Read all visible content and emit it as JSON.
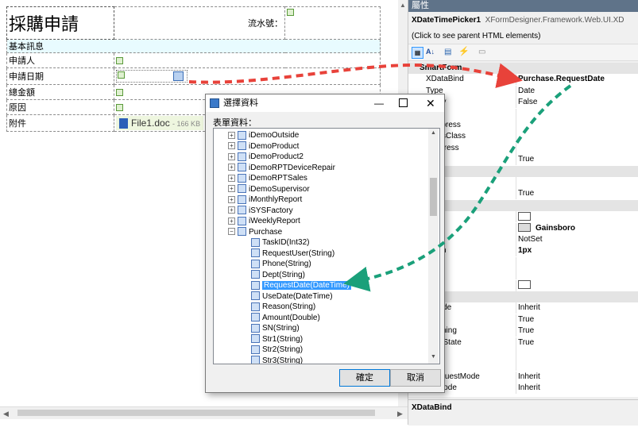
{
  "form": {
    "title": "採購申請",
    "serial_label": "流水號：",
    "section": "基本訊息",
    "rows": [
      {
        "label": "申請人"
      },
      {
        "label": "申請日期"
      },
      {
        "label": "總金額"
      },
      {
        "label": "原因"
      },
      {
        "label": "附件"
      }
    ],
    "attachment": "File1.doc",
    "attachment_size": "- 166 KB"
  },
  "properties": {
    "panel_title": "屬性",
    "component": "XDateTimePicker1",
    "component_type": "XFormDesigner.Framework.Web.UI.XD",
    "parent_link": "(Click to see parent HTML elements)",
    "rows": [
      {
        "kind": "cat",
        "name": "SmartForm",
        "value": ""
      },
      {
        "kind": "prop",
        "name": "XDataBind",
        "value": "Purchase.RequestDate",
        "bold": true
      },
      {
        "kind": "prop",
        "name": "Type",
        "value": "Date"
      },
      {
        "kind": "prop",
        "name": "yOnly",
        "value": "False"
      },
      {
        "kind": "prop",
        "name": "s",
        "value": ""
      },
      {
        "kind": "prop",
        "name": "leExpress",
        "value": ""
      },
      {
        "kind": "prop",
        "name": "leCssClass",
        "value": ""
      },
      {
        "kind": "prop",
        "name": "eExpress",
        "value": ""
      },
      {
        "kind": "prop",
        "name": "t",
        "value": "True"
      },
      {
        "kind": "cat",
        "name": "Mobile",
        "value": ""
      },
      {
        "kind": "prop",
        "name": "ame",
        "value": ""
      },
      {
        "kind": "prop",
        "name": "y",
        "value": "True"
      },
      {
        "kind": "cat",
        "name": "",
        "value": ""
      },
      {
        "kind": "prop",
        "name": "lor",
        "value": "",
        "swatch": "#ffffff"
      },
      {
        "kind": "prop",
        "name": "Color",
        "value": "Gainsboro",
        "swatch": "#dcdcdc",
        "bold": true
      },
      {
        "kind": "prop",
        "name": "Style",
        "value": "NotSet"
      },
      {
        "kind": "prop",
        "name": "Width",
        "value": "1px",
        "bold": true
      },
      {
        "kind": "prop",
        "name": "s",
        "value": ""
      },
      {
        "kind": "prop",
        "name": "",
        "value": ""
      },
      {
        "kind": "prop",
        "name": "olor",
        "value": "",
        "swatch": "#ffffff"
      },
      {
        "kind": "cat",
        "name": "",
        "value": ""
      },
      {
        "kind": "prop",
        "name": "DMode",
        "value": "Inherit"
      },
      {
        "kind": "prop",
        "name": "d",
        "value": "True"
      },
      {
        "kind": "prop",
        "name": "Theming",
        "value": "True"
      },
      {
        "kind": "prop",
        "name": "ViewState",
        "value": "True"
      },
      {
        "kind": "prop",
        "name": "",
        "value": ""
      },
      {
        "kind": "prop",
        "name": "o",
        "value": ""
      },
      {
        "kind": "prop",
        "name": "eRequestMode",
        "value": "Inherit"
      },
      {
        "kind": "prop",
        "name": "ateMode",
        "value": "Inherit"
      }
    ],
    "description_title": "XDataBind"
  },
  "dialog": {
    "title": "選擇資料",
    "label": "表單資料：",
    "tree": [
      {
        "text": "iDemoOutside",
        "level": 0,
        "exp": "+"
      },
      {
        "text": "iDemoProduct",
        "level": 0,
        "exp": "+"
      },
      {
        "text": "iDemoProduct2",
        "level": 0,
        "exp": "+"
      },
      {
        "text": "iDemoRPTDeviceRepair",
        "level": 0,
        "exp": "+"
      },
      {
        "text": "iDemoRPTSales",
        "level": 0,
        "exp": "+"
      },
      {
        "text": "iDemoSupervisor",
        "level": 0,
        "exp": "+"
      },
      {
        "text": "iMonthlyReport",
        "level": 0,
        "exp": "+"
      },
      {
        "text": "iSYSFactory",
        "level": 0,
        "exp": "+"
      },
      {
        "text": "iWeeklyReport",
        "level": 0,
        "exp": "+"
      },
      {
        "text": "Purchase",
        "level": 0,
        "exp": "−"
      },
      {
        "text": "TaskID(Int32)",
        "level": 1
      },
      {
        "text": "RequestUser(String)",
        "level": 1
      },
      {
        "text": "Phone(String)",
        "level": 1
      },
      {
        "text": "Dept(String)",
        "level": 1
      },
      {
        "text": "RequestDate(DateTime)",
        "level": 1,
        "selected": true
      },
      {
        "text": "UseDate(DateTime)",
        "level": 1
      },
      {
        "text": "Reason(String)",
        "level": 1
      },
      {
        "text": "Amount(Double)",
        "level": 1
      },
      {
        "text": "SN(String)",
        "level": 1
      },
      {
        "text": "Str1(String)",
        "level": 1
      },
      {
        "text": "Str2(String)",
        "level": 1
      },
      {
        "text": "Str3(String)",
        "level": 1
      }
    ],
    "ok_label": "確定",
    "cancel_label": "取消"
  },
  "colors": {
    "red_arrow": "#e8423a",
    "green_arrow": "#1aa07a",
    "selection": "#3399ff"
  }
}
